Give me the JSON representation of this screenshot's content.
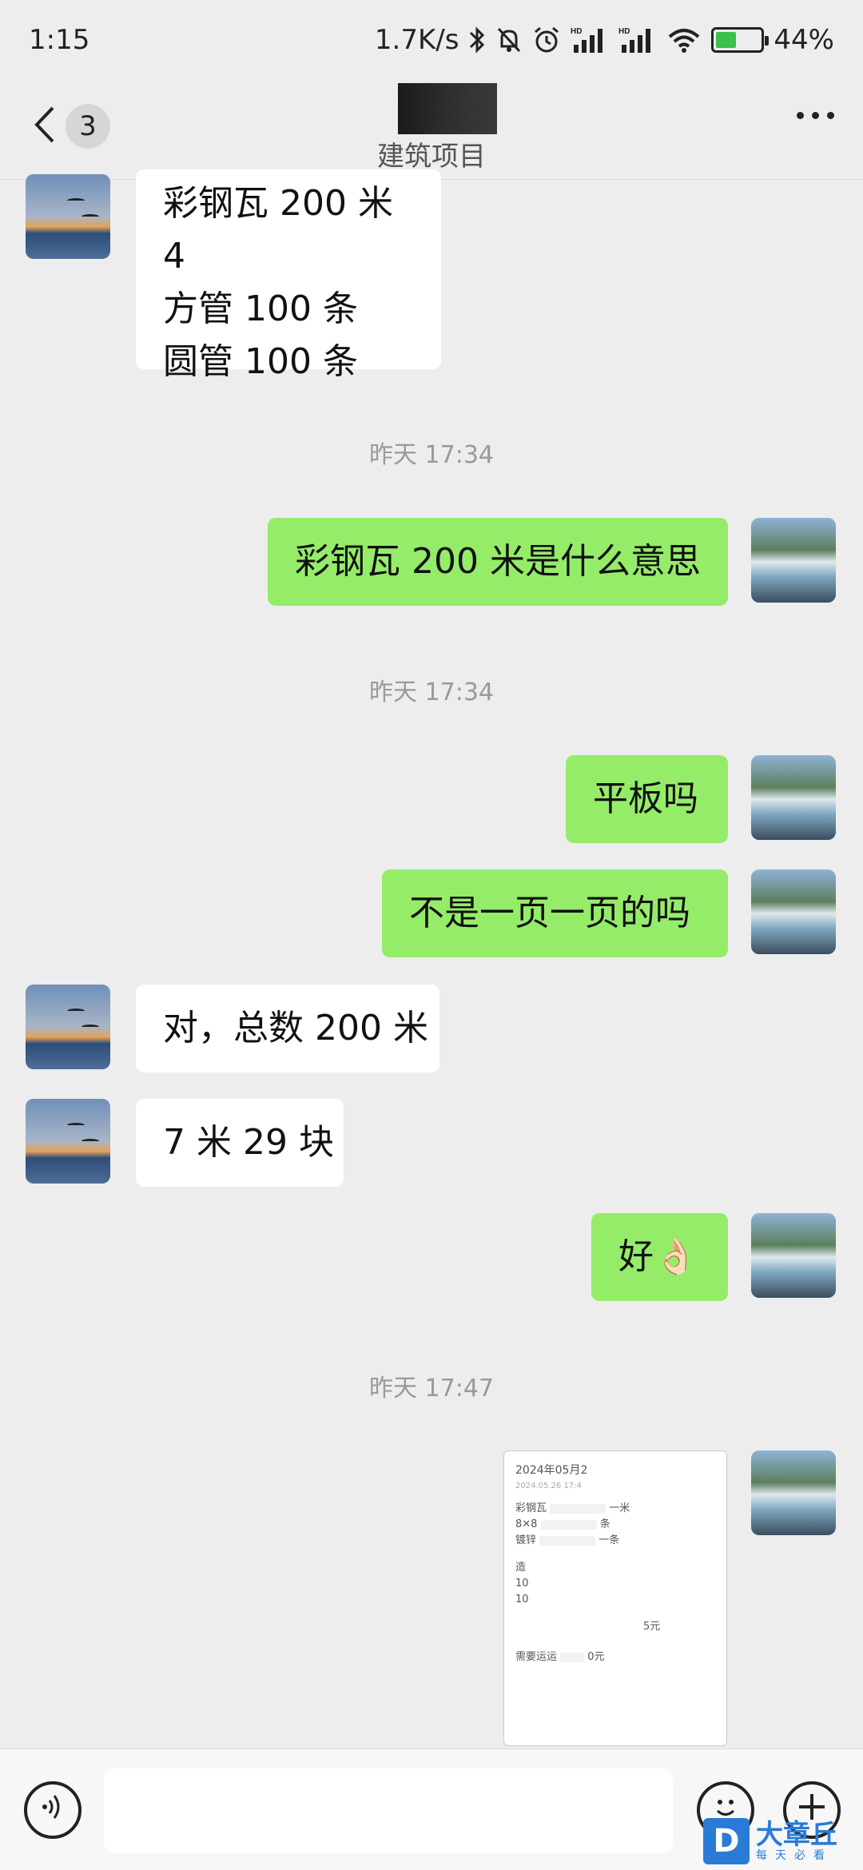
{
  "status_bar": {
    "time": "1:15",
    "net_speed": "1.7K/s",
    "signal_1": "HD",
    "signal_2": "HD",
    "battery_text": "44%",
    "battery_level": 44,
    "icons": [
      "bluetooth-icon",
      "mute-bell-icon",
      "alarm-icon",
      "signal-icon",
      "signal-icon",
      "wifi-icon",
      "battery-icon"
    ]
  },
  "header": {
    "unread_count": "3",
    "title": "建筑项目",
    "back_icon": "chevron-left-icon",
    "more_icon": "more-dots-icon"
  },
  "messages": [
    {
      "sender": "other",
      "lines": [
        "彩钢瓦 200 米 4",
        "方管 100 条",
        "圆管 100 条"
      ]
    },
    {
      "type": "time",
      "text": "昨天 17:34"
    },
    {
      "sender": "me",
      "text": "彩钢瓦 200 米是什么意思"
    },
    {
      "type": "time",
      "text": "昨天 17:34"
    },
    {
      "sender": "me",
      "text": "平板吗"
    },
    {
      "sender": "me",
      "text": "不是一页一页的吗"
    },
    {
      "sender": "other",
      "text": "对，总数 200 米"
    },
    {
      "sender": "other",
      "text": "7 米 29 块"
    },
    {
      "sender": "me",
      "text": "好👌🏻"
    },
    {
      "type": "time",
      "text": "昨天 17:47"
    }
  ],
  "image_message": {
    "lines": [
      "2024年05月2",
      "2024.05.26  17:4",
      "彩钢瓦",
      "一米",
      "8✕8",
      "条",
      "镀锌",
      "一条",
      "造",
      "10",
      "10",
      "5元",
      "需要运运",
      "0元"
    ]
  },
  "input_bar": {
    "voice_icon": "voice-icon",
    "emoji_icon": "emoji-icon",
    "plus_icon": "plus-icon"
  },
  "watermark": {
    "logo_letter": "D",
    "brand": "大章丘",
    "sub": "每天必看"
  }
}
